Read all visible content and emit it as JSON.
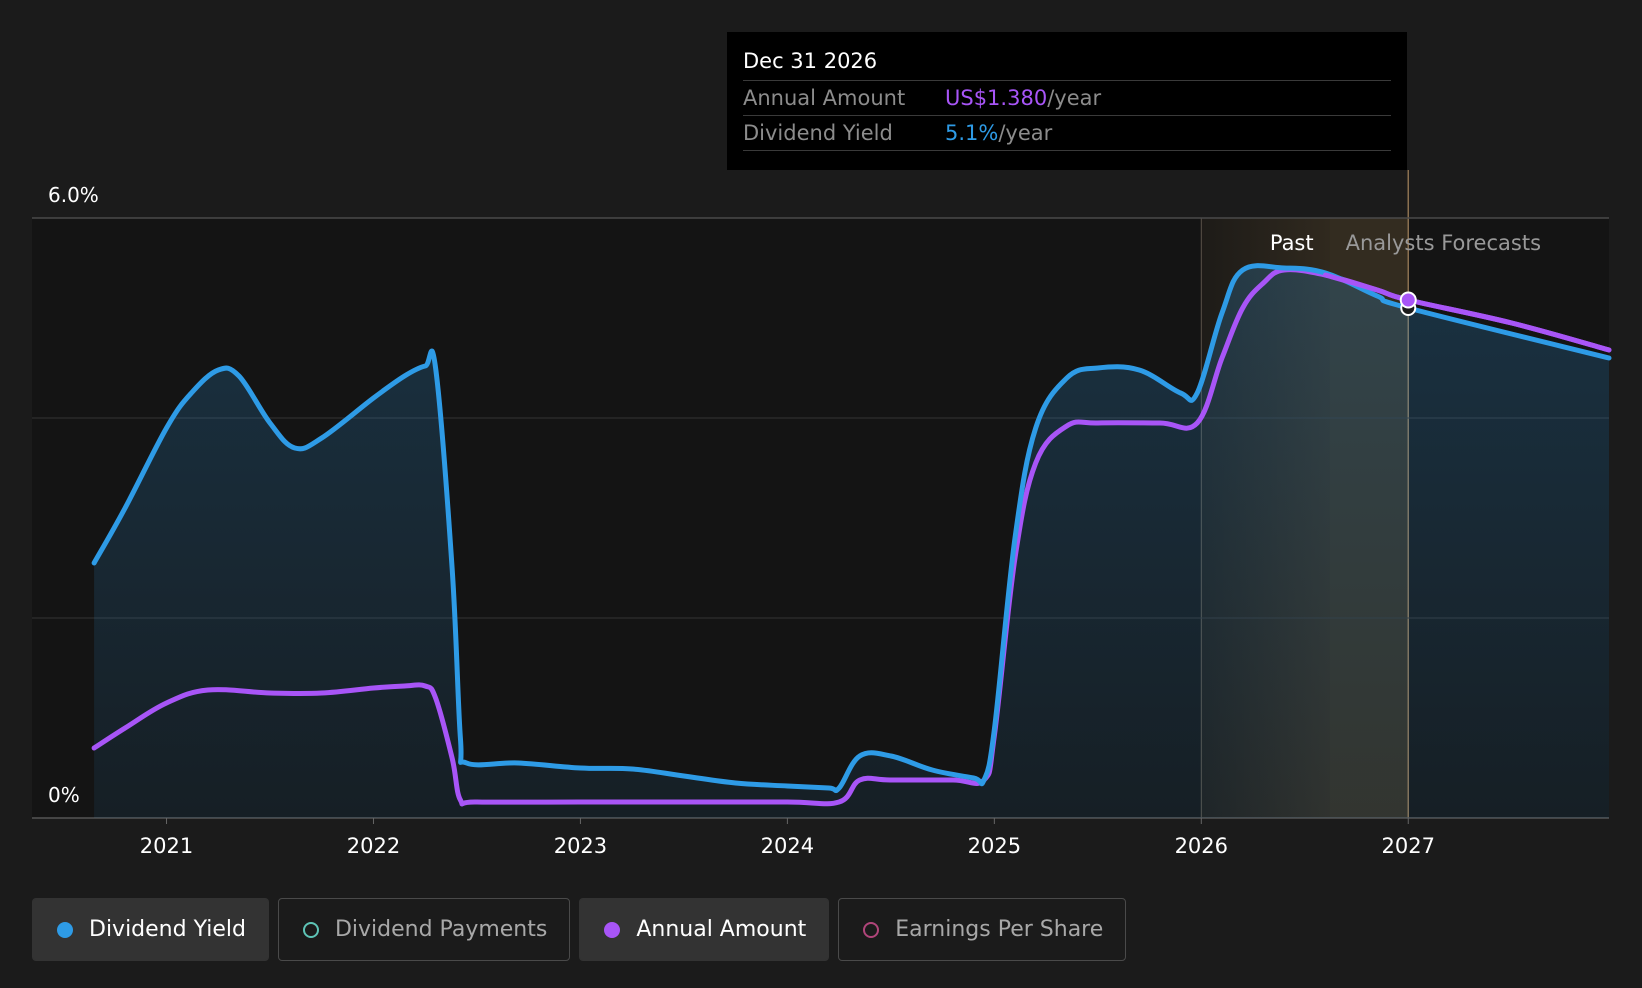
{
  "tooltip": {
    "date": "Dec 31 2026",
    "rows": [
      {
        "label": "Annual Amount",
        "value": "US$1.380",
        "unit": "/year",
        "color": "#a855f7"
      },
      {
        "label": "Dividend Yield",
        "value": "5.1%",
        "unit": "/year",
        "color": "#2e9be6"
      }
    ]
  },
  "legend": [
    {
      "label": "Dividend Yield",
      "color": "#2e9be6",
      "active": true
    },
    {
      "label": "Dividend Payments",
      "color": "#5ec4b6",
      "active": false
    },
    {
      "label": "Annual Amount",
      "color": "#a855f7",
      "active": true
    },
    {
      "label": "Earnings Per Share",
      "color": "#b0457a",
      "active": false
    }
  ],
  "chart_data": {
    "type": "line",
    "y_tick_labels": [
      "6.0%",
      "0%"
    ],
    "ylim": [
      0,
      6.0
    ],
    "x_ticks": [
      2021,
      2022,
      2023,
      2024,
      2025,
      2026,
      2027
    ],
    "xlim": [
      2020.35,
      2027.97
    ],
    "grid": true,
    "regions": [
      {
        "label": "Past",
        "start": 2026.0,
        "end": 2026.62
      },
      {
        "label": "Analysts Forecasts",
        "start": 2026.62,
        "end": 2027.0
      }
    ],
    "highlight_x": 2027.0,
    "series": [
      {
        "name": "Dividend Yield",
        "color": "#2e9be6",
        "points": [
          [
            2020.65,
            2.55
          ],
          [
            2020.8,
            3.1
          ],
          [
            2021.0,
            3.9
          ],
          [
            2021.12,
            4.25
          ],
          [
            2021.25,
            4.48
          ],
          [
            2021.35,
            4.42
          ],
          [
            2021.5,
            3.95
          ],
          [
            2021.62,
            3.7
          ],
          [
            2021.75,
            3.8
          ],
          [
            2022.0,
            4.2
          ],
          [
            2022.15,
            4.42
          ],
          [
            2022.25,
            4.52
          ],
          [
            2022.3,
            4.5
          ],
          [
            2022.38,
            2.5
          ],
          [
            2022.42,
            0.8
          ],
          [
            2022.45,
            0.55
          ],
          [
            2022.7,
            0.55
          ],
          [
            2023.0,
            0.5
          ],
          [
            2023.25,
            0.49
          ],
          [
            2023.5,
            0.42
          ],
          [
            2023.75,
            0.35
          ],
          [
            2024.0,
            0.32
          ],
          [
            2024.2,
            0.3
          ],
          [
            2024.25,
            0.3
          ],
          [
            2024.35,
            0.62
          ],
          [
            2024.5,
            0.62
          ],
          [
            2024.7,
            0.48
          ],
          [
            2024.9,
            0.4
          ],
          [
            2024.95,
            0.38
          ],
          [
            2025.0,
            0.88
          ],
          [
            2025.1,
            2.8
          ],
          [
            2025.2,
            3.9
          ],
          [
            2025.35,
            4.4
          ],
          [
            2025.5,
            4.5
          ],
          [
            2025.7,
            4.48
          ],
          [
            2025.9,
            4.25
          ],
          [
            2025.98,
            4.25
          ],
          [
            2026.1,
            5.05
          ],
          [
            2026.2,
            5.48
          ],
          [
            2026.4,
            5.5
          ],
          [
            2026.6,
            5.45
          ],
          [
            2026.85,
            5.22
          ],
          [
            2027.0,
            5.1
          ],
          [
            2027.97,
            4.6
          ]
        ]
      },
      {
        "name": "Annual Amount",
        "color": "#a855f7",
        "points": [
          [
            2020.65,
            0.7
          ],
          [
            2020.8,
            0.9
          ],
          [
            2021.0,
            1.15
          ],
          [
            2021.2,
            1.28
          ],
          [
            2021.5,
            1.25
          ],
          [
            2021.75,
            1.25
          ],
          [
            2022.0,
            1.3
          ],
          [
            2022.15,
            1.32
          ],
          [
            2022.25,
            1.32
          ],
          [
            2022.3,
            1.2
          ],
          [
            2022.38,
            0.6
          ],
          [
            2022.42,
            0.18
          ],
          [
            2022.5,
            0.16
          ],
          [
            2023.0,
            0.16
          ],
          [
            2023.5,
            0.16
          ],
          [
            2024.0,
            0.16
          ],
          [
            2024.25,
            0.16
          ],
          [
            2024.35,
            0.38
          ],
          [
            2024.5,
            0.38
          ],
          [
            2024.8,
            0.38
          ],
          [
            2024.95,
            0.38
          ],
          [
            2025.0,
            0.82
          ],
          [
            2025.1,
            2.6
          ],
          [
            2025.2,
            3.55
          ],
          [
            2025.35,
            3.92
          ],
          [
            2025.5,
            3.95
          ],
          [
            2025.8,
            3.95
          ],
          [
            2025.98,
            3.95
          ],
          [
            2026.1,
            4.6
          ],
          [
            2026.2,
            5.1
          ],
          [
            2026.3,
            5.35
          ],
          [
            2026.4,
            5.48
          ],
          [
            2026.6,
            5.43
          ],
          [
            2026.85,
            5.28
          ],
          [
            2027.0,
            5.18
          ],
          [
            2027.5,
            4.95
          ],
          [
            2027.97,
            4.68
          ]
        ]
      }
    ]
  }
}
